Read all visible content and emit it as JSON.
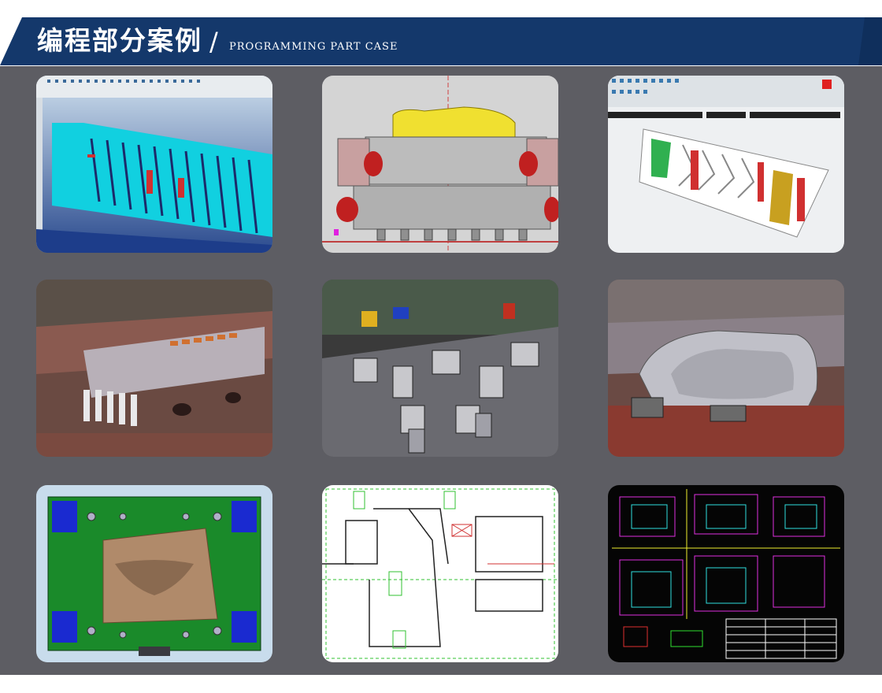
{
  "header": {
    "title_cn": "编程部分案例",
    "slash": "/",
    "title_en": "PROGRAMMING PART CASE"
  },
  "colors": {
    "banner": "#14386b",
    "banner_edge": "#0c2a55",
    "panel": "#5d5d63",
    "background": "#ffffff"
  },
  "gallery": {
    "tiles": [
      {
        "name": "cad-cyan-strip-layout"
      },
      {
        "name": "cad-die-section-drawing"
      },
      {
        "name": "cad-progressive-strip"
      },
      {
        "name": "photo-die-assembly"
      },
      {
        "name": "photo-machined-die-parts"
      },
      {
        "name": "photo-stamped-panel-die"
      },
      {
        "name": "cad-green-die-3d"
      },
      {
        "name": "cad-2d-section-lines"
      },
      {
        "name": "cad-black-2d-drawing"
      }
    ]
  }
}
